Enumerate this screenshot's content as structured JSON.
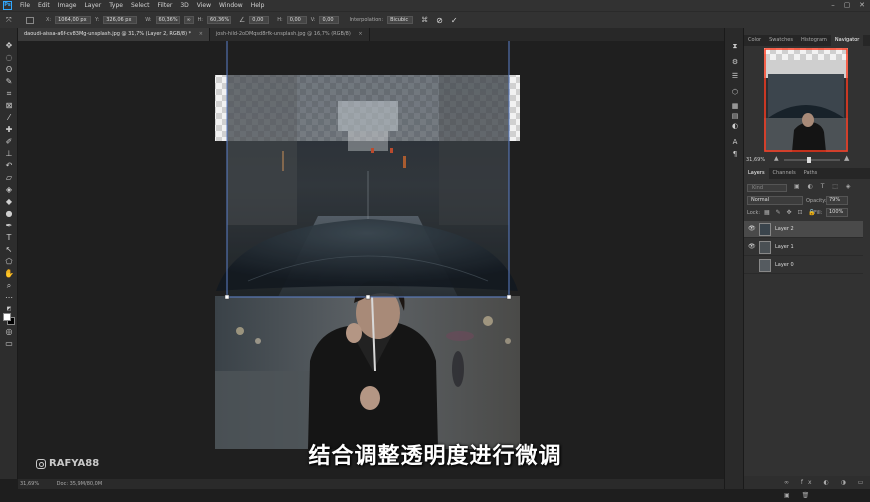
{
  "app": {
    "logo": "Ps"
  },
  "menu": [
    "File",
    "Edit",
    "Image",
    "Layer",
    "Type",
    "Select",
    "Filter",
    "3D",
    "View",
    "Window",
    "Help"
  ],
  "window_controls": [
    "–",
    "▢",
    "✕"
  ],
  "options": {
    "x_label": "X:",
    "x_value": "1064,00 px",
    "y_label": "Y:",
    "y_value": "326,06 px",
    "w_label": "W:",
    "w_value": "60,36%",
    "link": "∞",
    "h_label": "H:",
    "h_value": "60,36%",
    "angle_value": "0,00",
    "hskew_label": "H:",
    "hskew_value": "0,00",
    "vskew_label": "V:",
    "vskew_value": "0,00",
    "interp_label": "Interpolation:",
    "interp_value": "Bicubic",
    "cancel": "⊘",
    "commit": "✓"
  },
  "doc_tabs": [
    {
      "label": "daoudi-aissa-a6f-cv83Mg-unsplash.jpg @ 31,7% (Layer 2, RGB/8) *",
      "active": true,
      "close": "×"
    },
    {
      "label": "josh-hild-2oDMqsd8rfk-unsplash.jpg @ 16,7% (RGB/8)",
      "active": false,
      "close": "×"
    }
  ],
  "statusbar": {
    "zoom": "31,69%",
    "doc": "Doc: 35,9M/80,0M"
  },
  "panel_top": {
    "tabs": [
      "Color",
      "Swatches",
      "Histogram",
      "Navigator"
    ],
    "active": "Navigator",
    "zoom": "31,69%"
  },
  "panel_layers": {
    "tabs": [
      "Layers",
      "Channels",
      "Paths"
    ],
    "active": "Layers",
    "search_placeholder": "Kind",
    "blend_mode": "Normal",
    "opacity_label": "Opacity:",
    "opacity_value": "79%",
    "lock_label": "Lock:",
    "fill_label": "Fill:",
    "fill_value": "100%",
    "layers": [
      {
        "name": "Layer 2",
        "visible": true,
        "selected": true
      },
      {
        "name": "Layer 1",
        "visible": true,
        "selected": false
      },
      {
        "name": "Layer 0",
        "visible": false,
        "selected": false
      }
    ]
  },
  "caption": "结合调整透明度进行微调",
  "watermark": "RAFYA88",
  "colors": {
    "accent": "#31a8ff",
    "nav_box": "#ff3b1f",
    "bg": "#1e1e1e"
  }
}
